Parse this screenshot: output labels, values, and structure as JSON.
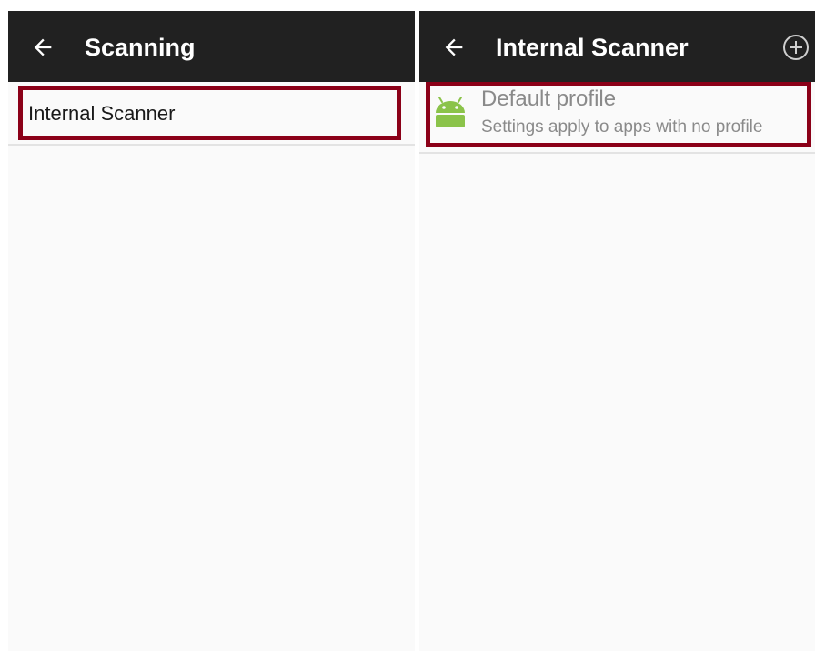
{
  "left_screen": {
    "appbar": {
      "title": "Scanning",
      "back_icon": "arrow-left-icon"
    },
    "items": [
      {
        "label": "Internal Scanner"
      }
    ]
  },
  "right_screen": {
    "appbar": {
      "title": "Internal Scanner",
      "back_icon": "arrow-left-icon",
      "action_icon": "add-circle-icon"
    },
    "items": [
      {
        "title": "Default profile",
        "subtitle": "Settings apply to apps with no profile",
        "icon": "android-icon"
      }
    ]
  },
  "colors": {
    "appbar": "#212121",
    "highlight": "#8b0018",
    "android_green": "#8bc34a",
    "list_background": "#fafafa"
  }
}
